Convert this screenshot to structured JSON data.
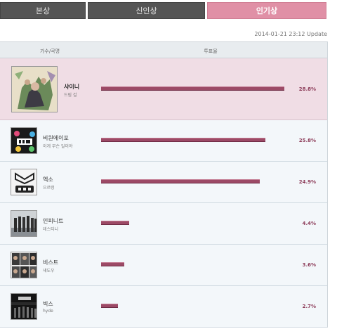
{
  "tabs": [
    {
      "label": "본상"
    },
    {
      "label": "신인상"
    },
    {
      "label": "인기상",
      "active": true
    }
  ],
  "update_text": "2014-01-21 23:12 Update",
  "columns": {
    "artist_song": "가수/곡명",
    "vote_rate": "투표율"
  },
  "rows": [
    {
      "artist": "샤이니",
      "song": "드림 걸",
      "percent_label": "28.8%",
      "percent": 28.8,
      "selected": true,
      "art_icon": "shinee-album-art"
    },
    {
      "artist": "비원에이포",
      "song": "이게 무슨 일이야",
      "percent_label": "25.8%",
      "percent": 25.8,
      "selected": false,
      "art_icon": "b1a4-album-art"
    },
    {
      "artist": "엑소",
      "song": "으르렁",
      "percent_label": "24.9%",
      "percent": 24.9,
      "selected": false,
      "art_icon": "exo-album-art"
    },
    {
      "artist": "인피니트",
      "song": "데스티니",
      "percent_label": "4.4%",
      "percent": 4.4,
      "selected": false,
      "art_icon": "infinite-album-art"
    },
    {
      "artist": "비스트",
      "song": "섀도우",
      "percent_label": "3.6%",
      "percent": 3.6,
      "selected": false,
      "art_icon": "beast-album-art"
    },
    {
      "artist": "빅스",
      "song": "hyde",
      "percent_label": "2.7%",
      "percent": 2.7,
      "selected": false,
      "art_icon": "vixx-album-art"
    }
  ],
  "colors": {
    "active_tab": "#e090a6",
    "inactive_tab": "#555555",
    "bar": "#9c4a66",
    "percent_text": "#8c3b58",
    "selected_row": "#f0dde5"
  }
}
